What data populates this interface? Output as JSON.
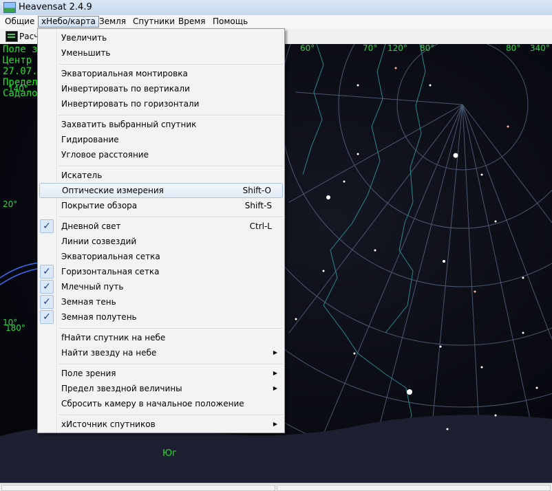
{
  "window": {
    "title": "Heavensat 2.4.9"
  },
  "menubar": {
    "items": [
      {
        "label": "Общие"
      },
      {
        "label": "хНебо/карта"
      },
      {
        "label": "Земля"
      },
      {
        "label": "Спутники"
      },
      {
        "label": "Время"
      },
      {
        "label": "Помощь"
      }
    ]
  },
  "toolbar": {
    "label": "Расче"
  },
  "sky": {
    "overlay_lines": [
      "Поле з",
      "Центр",
      "27.07.",
      "Предел",
      "Садало"
    ],
    "degree_labels": [
      "60°",
      "70°",
      "120°",
      "80°",
      "80°",
      "340°",
      "20°",
      "10°",
      "180°",
      "140°"
    ],
    "direction_label": "Юг",
    "colors": {
      "hud": "#22e028",
      "grid": "#5b6b86",
      "constellation": "#2a8a8a",
      "sky": "#07080f"
    }
  },
  "menu": {
    "groups": [
      [
        {
          "label": "Увеличить"
        },
        {
          "label": "Уменьшить"
        }
      ],
      [
        {
          "label": "Экваториальная монтировка"
        },
        {
          "label": "Инвертировать по вертикали"
        },
        {
          "label": "Инвертировать по горизонтали"
        }
      ],
      [
        {
          "label": "Захватить выбранный спутник"
        },
        {
          "label": "Гидирование"
        },
        {
          "label": "Угловое расстояние"
        }
      ],
      [
        {
          "label": "Искатель"
        },
        {
          "label": "Оптические измерения",
          "shortcut": "Shift-O"
        },
        {
          "label": "Покрытие обзора",
          "shortcut": "Shift-S"
        }
      ],
      [
        {
          "label": "Дневной свет",
          "shortcut": "Ctrl-L",
          "checked": true
        },
        {
          "label": "Линии созвездий"
        },
        {
          "label": "Экваториальная сетка"
        },
        {
          "label": "Горизонтальная сетка",
          "checked": true
        },
        {
          "label": "Млечный путь",
          "checked": true
        },
        {
          "label": "Земная тень",
          "checked": true
        },
        {
          "label": "Земная полутень",
          "checked": true
        }
      ],
      [
        {
          "label": "fНайти спутник на небе"
        },
        {
          "label": "Найти звезду на небе"
        }
      ],
      [
        {
          "label": "Поле зрения"
        },
        {
          "label": "Предел звездной величины"
        },
        {
          "label": "Сбросить камеру в начальное положение"
        }
      ],
      [
        {
          "label": "хИсточник спутников"
        }
      ]
    ],
    "check_glyph": "✓",
    "submenu_glyph": "▶"
  }
}
